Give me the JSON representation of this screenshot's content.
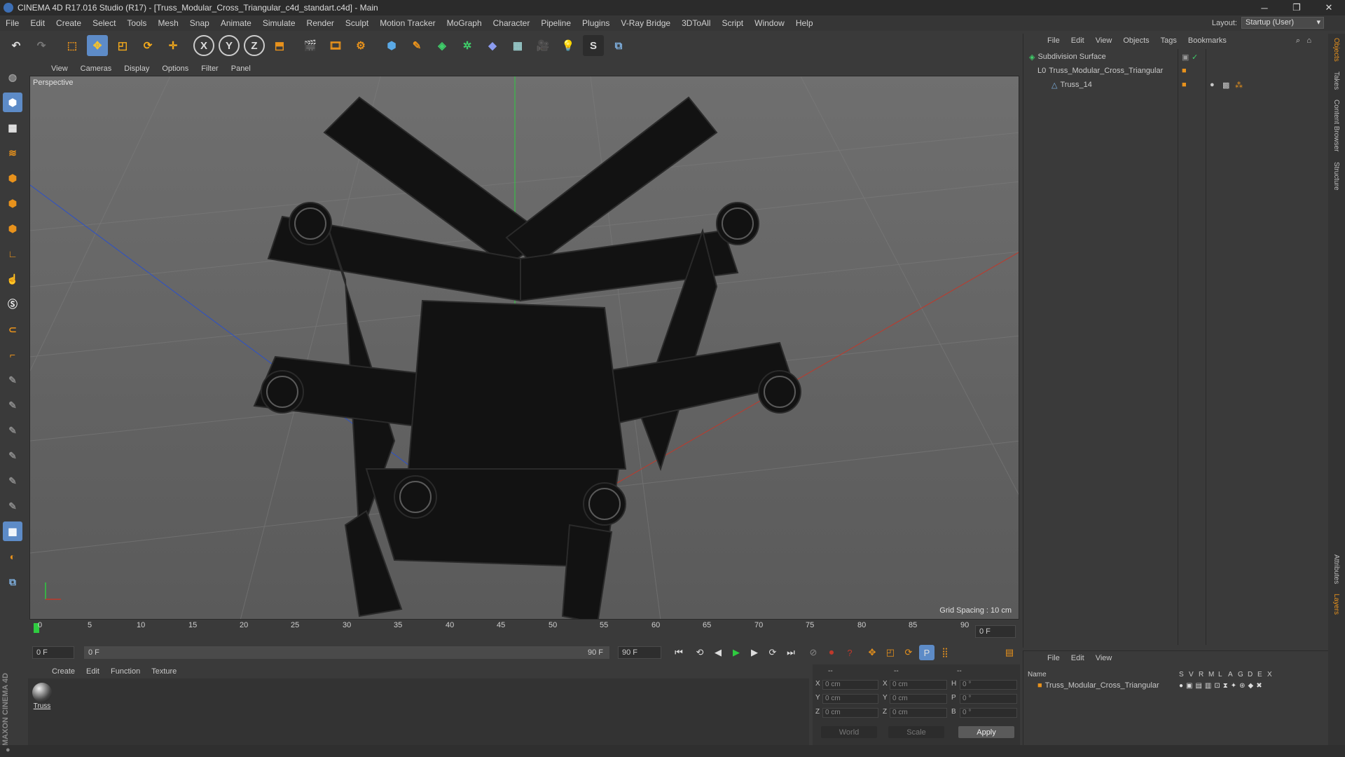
{
  "window": {
    "title": "CINEMA 4D R17.016 Studio (R17) - [Truss_Modular_Cross_Triangular_c4d_standart.c4d] - Main",
    "minimize": "─",
    "maximize": "❐",
    "close": "✕"
  },
  "menubar": {
    "items": [
      "File",
      "Edit",
      "Create",
      "Select",
      "Tools",
      "Mesh",
      "Snap",
      "Animate",
      "Simulate",
      "Render",
      "Sculpt",
      "Motion Tracker",
      "MoGraph",
      "Character",
      "Pipeline",
      "Plugins",
      "V-Ray Bridge",
      "3DToAll",
      "Script",
      "Window",
      "Help"
    ],
    "layout_label": "Layout:",
    "layout_value": "Startup (User)"
  },
  "toolbar": {
    "icons": [
      "undo-icon",
      "redo-icon",
      "live-selection-icon",
      "move-icon",
      "scale-icon",
      "rotate-icon",
      "transform-icon",
      "x-axis-icon",
      "y-axis-icon",
      "z-axis-icon",
      "world-coordinate-icon",
      "render-view-icon",
      "render-picture-viewer-icon",
      "render-settings-icon",
      "cube-icon",
      "pen-spline-icon",
      "subdivision-icon",
      "array-icon",
      "deformer-icon",
      "floor-icon",
      "camera-icon",
      "light-icon",
      "sculpt-icon",
      "python-icon"
    ],
    "x_label": "X",
    "y_label": "Y",
    "z_label": "Z"
  },
  "viewport": {
    "menu": [
      "View",
      "Cameras",
      "Display",
      "Options",
      "Filter",
      "Panel"
    ],
    "label": "Perspective",
    "grid_spacing": "Grid Spacing : 10 cm"
  },
  "timeline": {
    "ticks": [
      "0",
      "5",
      "10",
      "15",
      "20",
      "25",
      "30",
      "35",
      "40",
      "45",
      "50",
      "55",
      "60",
      "65",
      "70",
      "75",
      "80",
      "85",
      "90"
    ],
    "current_frame": "0 F",
    "start_field": "0 F",
    "slider_start": "0 F",
    "slider_end": "90 F",
    "end_field": "90 F"
  },
  "material_manager": {
    "menu": [
      "Create",
      "Edit",
      "Function",
      "Texture"
    ],
    "material_name": "Truss"
  },
  "coordinates": {
    "header_a": "--",
    "header_b": "--",
    "header_c": "--",
    "rows": [
      {
        "axis": "X",
        "pos": "0 cm",
        "axis2": "X",
        "size": "0 cm",
        "rot_axis": "H",
        "rot": "0 °"
      },
      {
        "axis": "Y",
        "pos": "0 cm",
        "axis2": "Y",
        "size": "0 cm",
        "rot_axis": "P",
        "rot": "0 °"
      },
      {
        "axis": "Z",
        "pos": "0 cm",
        "axis2": "Z",
        "size": "0 cm",
        "rot_axis": "B",
        "rot": "0 °"
      }
    ],
    "mode": "World",
    "transform": "Scale",
    "apply": "Apply"
  },
  "object_manager": {
    "menu": [
      "File",
      "Edit",
      "View",
      "Objects",
      "Tags",
      "Bookmarks"
    ],
    "objects": [
      {
        "name": "Subdivision Surface",
        "indent": 0
      },
      {
        "name": "Truss_Modular_Cross_Triangular",
        "indent": 1
      },
      {
        "name": "Truss_14",
        "indent": 2
      }
    ]
  },
  "attribute_manager": {
    "menu": [
      "File",
      "Edit",
      "View"
    ],
    "columns": [
      "Name",
      "S",
      "V",
      "R",
      "M",
      "L",
      "A",
      "G",
      "D",
      "E",
      "X"
    ],
    "row_name": "Truss_Modular_Cross_Triangular"
  },
  "right_tabs": [
    "Objects",
    "Takes",
    "Content Browser",
    "Structure",
    "Attributes",
    "Layers"
  ],
  "brand": "MAXON CINEMA 4D",
  "colors": {
    "accent_orange": "#e8921c",
    "selection_blue": "#5d8bc7",
    "axis_red": "#c0392b",
    "axis_green": "#2ecc40",
    "axis_blue": "#2c50c8"
  }
}
